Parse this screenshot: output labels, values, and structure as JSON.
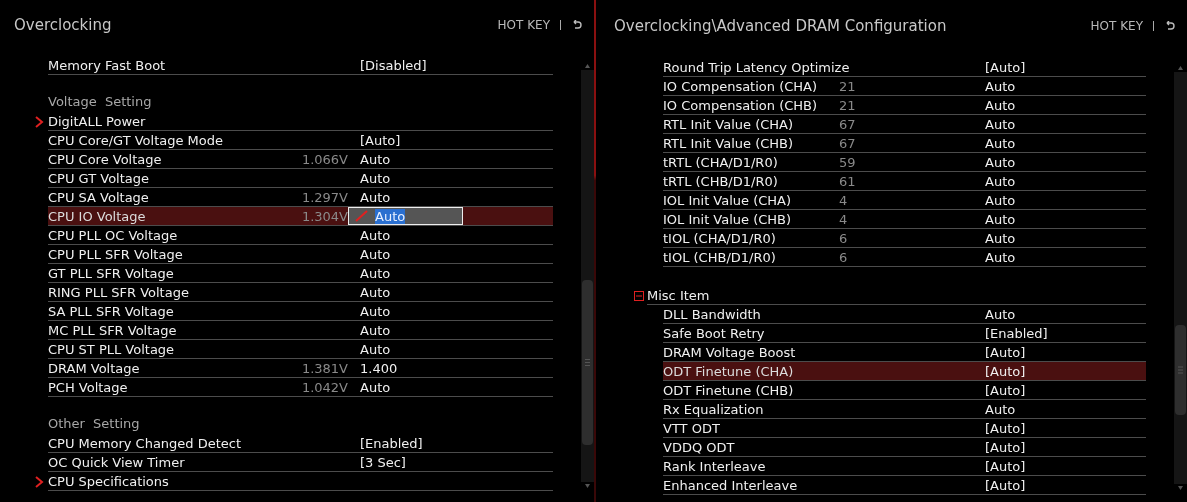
{
  "panels": [
    {
      "title": "Overclocking",
      "hotkey": "HOT KEY",
      "rows": [
        {
          "kind": "setting",
          "label": "Memory Fast Boot",
          "value": "[Disabled]",
          "selected": false,
          "editing": false
        },
        {
          "kind": "section",
          "label": "Voltage Setting"
        },
        {
          "kind": "submenu",
          "label": "DigitALL Power",
          "selected": false
        },
        {
          "kind": "setting",
          "label": "CPU Core/GT Voltage Mode",
          "value": "[Auto]",
          "selected": false,
          "editing": false
        },
        {
          "kind": "setting",
          "label": "CPU Core Voltage",
          "reading": "1.066V",
          "value": "Auto",
          "selected": false,
          "editing": false
        },
        {
          "kind": "setting",
          "label": "CPU GT Voltage",
          "value": "Auto",
          "selected": false,
          "editing": false
        },
        {
          "kind": "setting",
          "label": "CPU SA Voltage",
          "reading": "1.297V",
          "value": "Auto",
          "selected": false,
          "editing": false
        },
        {
          "kind": "setting",
          "label": "CPU IO Voltage",
          "reading": "1.304V",
          "value": "Auto",
          "selected": true,
          "editing": true
        },
        {
          "kind": "setting",
          "label": "CPU PLL OC Voltage",
          "value": "Auto",
          "selected": false,
          "editing": false
        },
        {
          "kind": "setting",
          "label": "CPU PLL SFR Voltage",
          "value": "Auto",
          "selected": false,
          "editing": false
        },
        {
          "kind": "setting",
          "label": "GT PLL SFR Voltage",
          "value": "Auto",
          "selected": false,
          "editing": false
        },
        {
          "kind": "setting",
          "label": "RING PLL SFR Voltage",
          "value": "Auto",
          "selected": false,
          "editing": false
        },
        {
          "kind": "setting",
          "label": "SA PLL SFR Voltage",
          "value": "Auto",
          "selected": false,
          "editing": false
        },
        {
          "kind": "setting",
          "label": "MC PLL SFR Voltage",
          "value": "Auto",
          "selected": false,
          "editing": false
        },
        {
          "kind": "setting",
          "label": "CPU ST PLL Voltage",
          "value": "Auto",
          "selected": false,
          "editing": false
        },
        {
          "kind": "setting",
          "label": "DRAM Voltage",
          "reading": "1.381V",
          "value": "1.400",
          "selected": false,
          "editing": false
        },
        {
          "kind": "setting",
          "label": "PCH Voltage",
          "reading": "1.042V",
          "value": "Auto",
          "selected": false,
          "editing": false
        },
        {
          "kind": "section",
          "label": "Other Setting"
        },
        {
          "kind": "setting",
          "label": "CPU Memory Changed Detect",
          "value": "[Enabled]",
          "selected": false,
          "editing": false
        },
        {
          "kind": "setting",
          "label": "OC Quick View Timer",
          "value": "[3 Sec]",
          "selected": false,
          "editing": false
        },
        {
          "kind": "submenu",
          "label": "CPU Specifications",
          "selected": false
        }
      ]
    },
    {
      "title": "Overclocking\\Advanced DRAM Configuration",
      "hotkey": "HOT KEY",
      "rows": [
        {
          "kind": "setting",
          "label": "Round Trip Latency Optimize",
          "value": "[Auto]",
          "selected": false,
          "editing": false
        },
        {
          "kind": "setting",
          "label": "IO Compensation (CHA)",
          "reading": "21",
          "value": "Auto",
          "selected": false,
          "editing": false
        },
        {
          "kind": "setting",
          "label": "IO Compensation (CHB)",
          "reading": "21",
          "value": "Auto",
          "selected": false,
          "editing": false
        },
        {
          "kind": "setting",
          "label": "RTL Init Value (CHA)",
          "reading": "67",
          "value": "Auto",
          "selected": false,
          "editing": false
        },
        {
          "kind": "setting",
          "label": "RTL Init Value (CHB)",
          "reading": "67",
          "value": "Auto",
          "selected": false,
          "editing": false
        },
        {
          "kind": "setting",
          "label": "tRTL (CHA/D1/R0)",
          "reading": "59",
          "value": "Auto",
          "selected": false,
          "editing": false
        },
        {
          "kind": "setting",
          "label": "tRTL (CHB/D1/R0)",
          "reading": "61",
          "value": "Auto",
          "selected": false,
          "editing": false
        },
        {
          "kind": "setting",
          "label": "IOL Init Value (CHA)",
          "reading": "4",
          "value": "Auto",
          "selected": false,
          "editing": false
        },
        {
          "kind": "setting",
          "label": "IOL Init Value (CHB)",
          "reading": "4",
          "value": "Auto",
          "selected": false,
          "editing": false
        },
        {
          "kind": "setting",
          "label": "tIOL (CHA/D1/R0)",
          "reading": "6",
          "value": "Auto",
          "selected": false,
          "editing": false
        },
        {
          "kind": "setting",
          "label": "tIOL (CHB/D1/R0)",
          "reading": "6",
          "value": "Auto",
          "selected": false,
          "editing": false
        },
        {
          "kind": "group",
          "label": "Misc Item",
          "expanded": true,
          "selected": false,
          "children": [
            {
              "kind": "setting",
              "label": "DLL Bandwidth",
              "value": "Auto",
              "selected": false,
              "editing": false
            },
            {
              "kind": "setting",
              "label": "Safe Boot Retry",
              "value": "[Enabled]",
              "selected": false,
              "editing": false
            },
            {
              "kind": "setting",
              "label": "DRAM Voltage Boost",
              "value": "[Auto]",
              "selected": false,
              "editing": false
            },
            {
              "kind": "setting",
              "label": "ODT Finetune (CHA)",
              "value": "[Auto]",
              "selected": true,
              "editing": false
            },
            {
              "kind": "setting",
              "label": "ODT Finetune (CHB)",
              "value": "[Auto]",
              "selected": false,
              "editing": false
            },
            {
              "kind": "setting",
              "label": "Rx Equalization",
              "value": "Auto",
              "selected": false,
              "editing": false
            },
            {
              "kind": "setting",
              "label": "VTT ODT",
              "value": "[Auto]",
              "selected": false,
              "editing": false
            },
            {
              "kind": "setting",
              "label": "VDDQ ODT",
              "value": "[Auto]",
              "selected": false,
              "editing": false
            },
            {
              "kind": "setting",
              "label": "Rank Interleave",
              "value": "[Auto]",
              "selected": false,
              "editing": false
            },
            {
              "kind": "setting",
              "label": "Enhanced Interleave",
              "value": "[Auto]",
              "selected": false,
              "editing": false
            }
          ]
        }
      ]
    }
  ]
}
